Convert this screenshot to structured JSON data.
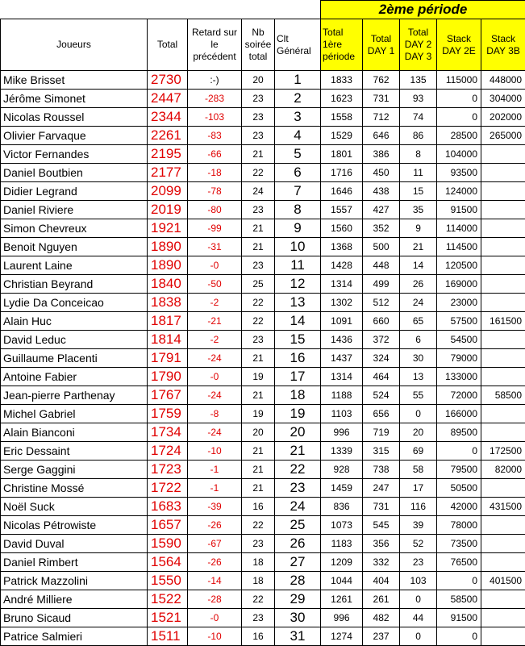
{
  "periode2_title": "2ème période",
  "headers": {
    "joueurs": "Joueurs",
    "total": "Total",
    "retard": "Retard sur le précédent",
    "nb": "Nb soirée total",
    "clt": "Clt Général",
    "total1": "Total 1ère période",
    "day1": "Total DAY 1",
    "day23": "Total DAY 2 DAY 3",
    "stack2e": "Stack DAY 2E",
    "stack3b": "Stack DAY 3B"
  },
  "rows": [
    {
      "name": "Mike Brisset",
      "total": "2730",
      "retard": ":-)",
      "nb": "20",
      "clt": "1",
      "t1": "1833",
      "d1": "762",
      "d23": "135",
      "s2e": "115000",
      "s3b": "448000"
    },
    {
      "name": "Jérôme Simonet",
      "total": "2447",
      "retard": "-283",
      "nb": "23",
      "clt": "2",
      "t1": "1623",
      "d1": "731",
      "d23": "93",
      "s2e": "0",
      "s3b": "304000"
    },
    {
      "name": "Nicolas Roussel",
      "total": "2344",
      "retard": "-103",
      "nb": "23",
      "clt": "3",
      "t1": "1558",
      "d1": "712",
      "d23": "74",
      "s2e": "0",
      "s3b": "202000"
    },
    {
      "name": "Olivier Farvaque",
      "total": "2261",
      "retard": "-83",
      "nb": "23",
      "clt": "4",
      "t1": "1529",
      "d1": "646",
      "d23": "86",
      "s2e": "28500",
      "s3b": "265000"
    },
    {
      "name": "Victor Fernandes",
      "total": "2195",
      "retard": "-66",
      "nb": "21",
      "clt": "5",
      "t1": "1801",
      "d1": "386",
      "d23": "8",
      "s2e": "104000",
      "s3b": ""
    },
    {
      "name": "Daniel Boutbien",
      "total": "2177",
      "retard": "-18",
      "nb": "22",
      "clt": "6",
      "t1": "1716",
      "d1": "450",
      "d23": "11",
      "s2e": "93500",
      "s3b": ""
    },
    {
      "name": "Didier Legrand",
      "total": "2099",
      "retard": "-78",
      "nb": "24",
      "clt": "7",
      "t1": "1646",
      "d1": "438",
      "d23": "15",
      "s2e": "124000",
      "s3b": ""
    },
    {
      "name": "Daniel Riviere",
      "total": "2019",
      "retard": "-80",
      "nb": "23",
      "clt": "8",
      "t1": "1557",
      "d1": "427",
      "d23": "35",
      "s2e": "91500",
      "s3b": ""
    },
    {
      "name": "Simon Chevreux",
      "total": "1921",
      "retard": "-99",
      "nb": "21",
      "clt": "9",
      "t1": "1560",
      "d1": "352",
      "d23": "9",
      "s2e": "114000",
      "s3b": ""
    },
    {
      "name": "Benoit Nguyen",
      "total": "1890",
      "retard": "-31",
      "nb": "21",
      "clt": "10",
      "t1": "1368",
      "d1": "500",
      "d23": "21",
      "s2e": "114500",
      "s3b": ""
    },
    {
      "name": "Laurent Laine",
      "total": "1890",
      "retard": "-0",
      "nb": "23",
      "clt": "11",
      "t1": "1428",
      "d1": "448",
      "d23": "14",
      "s2e": "120500",
      "s3b": ""
    },
    {
      "name": "Christian Beyrand",
      "total": "1840",
      "retard": "-50",
      "nb": "25",
      "clt": "12",
      "t1": "1314",
      "d1": "499",
      "d23": "26",
      "s2e": "169000",
      "s3b": ""
    },
    {
      "name": "Lydie Da Conceicao",
      "total": "1838",
      "retard": "-2",
      "nb": "22",
      "clt": "13",
      "t1": "1302",
      "d1": "512",
      "d23": "24",
      "s2e": "23000",
      "s3b": ""
    },
    {
      "name": "Alain Huc",
      "total": "1817",
      "retard": "-21",
      "nb": "22",
      "clt": "14",
      "t1": "1091",
      "d1": "660",
      "d23": "65",
      "s2e": "57500",
      "s3b": "161500"
    },
    {
      "name": "David Leduc",
      "total": "1814",
      "retard": "-2",
      "nb": "23",
      "clt": "15",
      "t1": "1436",
      "d1": "372",
      "d23": "6",
      "s2e": "54500",
      "s3b": ""
    },
    {
      "name": "Guillaume Placenti",
      "total": "1791",
      "retard": "-24",
      "nb": "21",
      "clt": "16",
      "t1": "1437",
      "d1": "324",
      "d23": "30",
      "s2e": "79000",
      "s3b": ""
    },
    {
      "name": "Antoine Fabier",
      "total": "1790",
      "retard": "-0",
      "nb": "19",
      "clt": "17",
      "t1": "1314",
      "d1": "464",
      "d23": "13",
      "s2e": "133000",
      "s3b": ""
    },
    {
      "name": "Jean-pierre Parthenay",
      "total": "1767",
      "retard": "-24",
      "nb": "21",
      "clt": "18",
      "t1": "1188",
      "d1": "524",
      "d23": "55",
      "s2e": "72000",
      "s3b": "58500"
    },
    {
      "name": "Michel Gabriel",
      "total": "1759",
      "retard": "-8",
      "nb": "19",
      "clt": "19",
      "t1": "1103",
      "d1": "656",
      "d23": "0",
      "s2e": "166000",
      "s3b": ""
    },
    {
      "name": "Alain Bianconi",
      "total": "1734",
      "retard": "-24",
      "nb": "20",
      "clt": "20",
      "t1": "996",
      "d1": "719",
      "d23": "20",
      "s2e": "89500",
      "s3b": ""
    },
    {
      "name": "Eric Dessaint",
      "total": "1724",
      "retard": "-10",
      "nb": "21",
      "clt": "21",
      "t1": "1339",
      "d1": "315",
      "d23": "69",
      "s2e": "0",
      "s3b": "172500"
    },
    {
      "name": "Serge Gaggini",
      "total": "1723",
      "retard": "-1",
      "nb": "21",
      "clt": "22",
      "t1": "928",
      "d1": "738",
      "d23": "58",
      "s2e": "79500",
      "s3b": "82000"
    },
    {
      "name": "Christine Mossé",
      "total": "1722",
      "retard": "-1",
      "nb": "21",
      "clt": "23",
      "t1": "1459",
      "d1": "247",
      "d23": "17",
      "s2e": "50500",
      "s3b": ""
    },
    {
      "name": "Noël Suck",
      "total": "1683",
      "retard": "-39",
      "nb": "16",
      "clt": "24",
      "t1": "836",
      "d1": "731",
      "d23": "116",
      "s2e": "42000",
      "s3b": "431500"
    },
    {
      "name": "Nicolas Pétrowiste",
      "total": "1657",
      "retard": "-26",
      "nb": "22",
      "clt": "25",
      "t1": "1073",
      "d1": "545",
      "d23": "39",
      "s2e": "78000",
      "s3b": ""
    },
    {
      "name": "David Duval",
      "total": "1590",
      "retard": "-67",
      "nb": "23",
      "clt": "26",
      "t1": "1183",
      "d1": "356",
      "d23": "52",
      "s2e": "73500",
      "s3b": ""
    },
    {
      "name": "Daniel Rimbert",
      "total": "1564",
      "retard": "-26",
      "nb": "18",
      "clt": "27",
      "t1": "1209",
      "d1": "332",
      "d23": "23",
      "s2e": "76500",
      "s3b": ""
    },
    {
      "name": "Patrick Mazzolini",
      "total": "1550",
      "retard": "-14",
      "nb": "18",
      "clt": "28",
      "t1": "1044",
      "d1": "404",
      "d23": "103",
      "s2e": "0",
      "s3b": "401500"
    },
    {
      "name": "André Milliere",
      "total": "1522",
      "retard": "-28",
      "nb": "22",
      "clt": "29",
      "t1": "1261",
      "d1": "261",
      "d23": "0",
      "s2e": "58500",
      "s3b": ""
    },
    {
      "name": "Bruno Sicaud",
      "total": "1521",
      "retard": "-0",
      "nb": "23",
      "clt": "30",
      "t1": "996",
      "d1": "482",
      "d23": "44",
      "s2e": "91500",
      "s3b": ""
    },
    {
      "name": "Patrice Salmieri",
      "total": "1511",
      "retard": "-10",
      "nb": "16",
      "clt": "31",
      "t1": "1274",
      "d1": "237",
      "d23": "0",
      "s2e": "0",
      "s3b": ""
    }
  ]
}
